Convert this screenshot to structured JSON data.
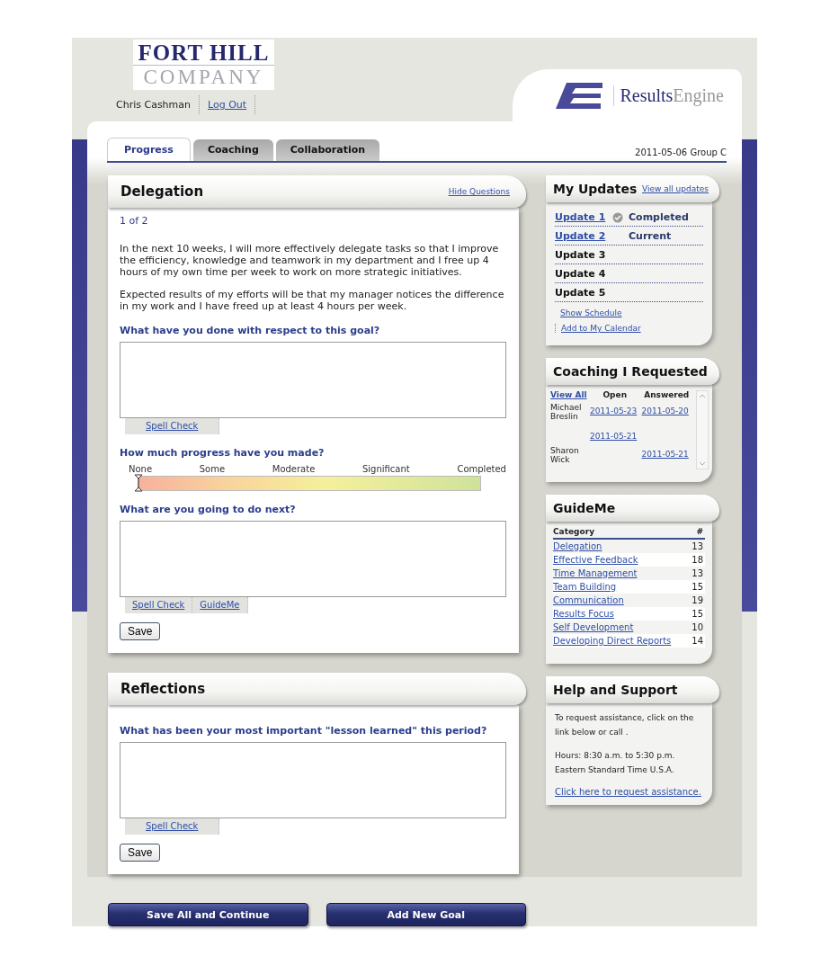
{
  "header": {
    "logo_lines": [
      "FORT HILL",
      "COMPANY"
    ],
    "user_name": "Chris Cashman",
    "logout": "Log Out",
    "brand": [
      "Results",
      "Engine"
    ]
  },
  "tabs": [
    {
      "label": "Progress",
      "selected": true
    },
    {
      "label": "Coaching",
      "selected": false
    },
    {
      "label": "Collaboration",
      "selected": false
    }
  ],
  "date_group": "2011-05-06 Group C",
  "goal": {
    "title": "Delegation",
    "hide_link": "Hide Questions",
    "counter": "1 of 2",
    "paragraphs": [
      "In the next 10 weeks, I will more effectively delegate tasks so that I improve the efficiency, knowledge and teamwork in my department and I free up 4 hours of my own time per week to work on more strategic initiatives.",
      "Expected results of my efforts will be that my manager notices the difference in my work and I have freed up at least 4 hours per week."
    ],
    "questions": [
      {
        "kind": "text",
        "label": "What have you done with respect to this goal?",
        "tools": [
          "Spell Check"
        ]
      },
      {
        "kind": "slider",
        "label": "How much progress have you made?",
        "scale": [
          "None",
          "Some",
          "Moderate",
          "Significant",
          "Completed"
        ],
        "level": 0
      },
      {
        "kind": "text",
        "label": "What are you going to do next?",
        "tools": [
          "Spell Check",
          "GuideMe"
        ]
      }
    ],
    "save": "Save"
  },
  "reflections": {
    "title": "Reflections",
    "questions": [
      {
        "kind": "text",
        "label": "What has been your most important \"lesson learned\" this period?",
        "tools": [
          "Spell Check"
        ]
      }
    ],
    "save": "Save"
  },
  "actions": [
    "Save All and Continue",
    "Add New Goal"
  ],
  "updates": {
    "title": "My Updates",
    "view_all": "View all updates",
    "items": [
      {
        "label": "Update 1",
        "linked": true,
        "done": true,
        "status": "Completed"
      },
      {
        "label": "Update 2",
        "linked": true,
        "done": false,
        "status": "Current"
      },
      {
        "label": "Update 3",
        "linked": false,
        "done": false
      },
      {
        "label": "Update 4",
        "linked": false,
        "done": false
      },
      {
        "label": "Update 5",
        "linked": false,
        "done": false
      }
    ],
    "links": [
      "Show Schedule",
      "Add to My Calendar"
    ]
  },
  "coaching": {
    "title": "Coaching I Requested",
    "columns": [
      "View All",
      "Open",
      "Answered"
    ],
    "rows": [
      {
        "name": "Michael Breslin",
        "open": "2011-05-23",
        "answered": "2011-05-20"
      },
      {
        "open": "2011-05-21"
      },
      {
        "name": "Sharon Wick",
        "answered": "2011-05-21"
      }
    ]
  },
  "guide": {
    "title": "GuideMe",
    "columns": [
      "Category",
      "#"
    ],
    "rows": [
      {
        "category": "Delegation",
        "count": "13"
      },
      {
        "category": "Effective Feedback",
        "count": "18"
      },
      {
        "category": "Time Management",
        "count": "13"
      },
      {
        "category": "Team Building",
        "count": "15"
      },
      {
        "category": "Communication",
        "count": "19"
      },
      {
        "category": "Results Focus",
        "count": "15"
      },
      {
        "category": "Self Development",
        "count": "10"
      },
      {
        "category": "Developing Direct Reports",
        "count": "14"
      }
    ]
  },
  "help": {
    "title": "Help and Support",
    "paragraphs": [
      "To request assistance, click on the link below or call .",
      "Hours: 8:30 a.m. to 5:30 p.m. Eastern Standard Time U.S.A."
    ],
    "link": "Click here to request assistance."
  }
}
